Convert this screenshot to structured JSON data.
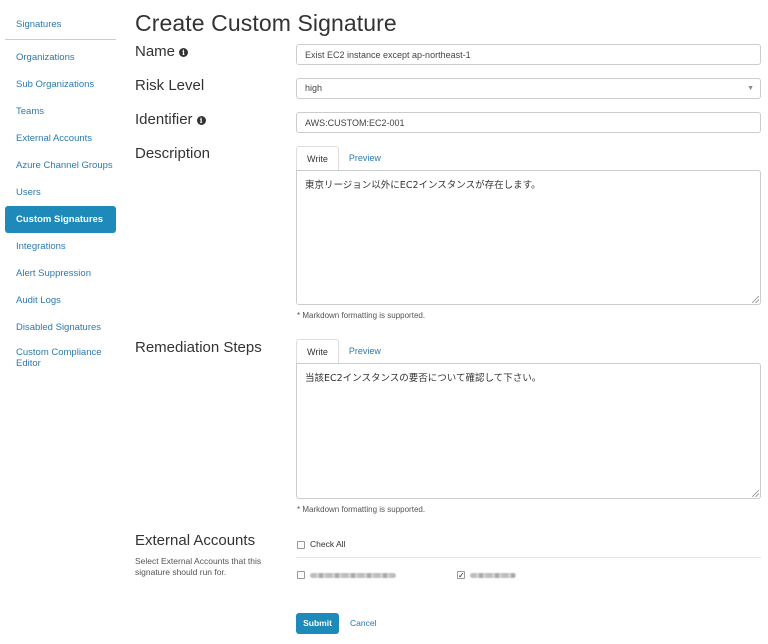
{
  "sidebar": {
    "items": [
      {
        "label": "Signatures"
      },
      {
        "label": "Organizations"
      },
      {
        "label": "Sub Organizations"
      },
      {
        "label": "Teams"
      },
      {
        "label": "External Accounts"
      },
      {
        "label": "Azure Channel Groups"
      },
      {
        "label": "Users"
      },
      {
        "label": "Custom Signatures",
        "active": true
      },
      {
        "label": "Integrations"
      },
      {
        "label": "Alert Suppression"
      },
      {
        "label": "Audit Logs"
      },
      {
        "label": "Disabled Signatures"
      },
      {
        "label": "Custom Compliance Editor"
      }
    ]
  },
  "page": {
    "title": "Create Custom Signature"
  },
  "form": {
    "name": {
      "label": "Name",
      "value": "Exist EC2 instance except ap-northeast-1",
      "icon": "info-icon"
    },
    "risk_level": {
      "label": "Risk Level",
      "value": "high"
    },
    "identifier": {
      "label": "Identifier",
      "value": "AWS:CUSTOM:EC2-001",
      "icon": "info-icon"
    },
    "description": {
      "label": "Description",
      "tab_write": "Write",
      "tab_preview": "Preview",
      "value": "東京リージョン以外にEC2インスタンスが存在します。",
      "hint": "* Markdown formatting is supported."
    },
    "remediation": {
      "label": "Remediation Steps",
      "tab_write": "Write",
      "tab_preview": "Preview",
      "value": "当該EC2インスタンスの要否について確認して下さい。",
      "hint": "* Markdown formatting is supported."
    },
    "external_accounts": {
      "label": "External Accounts",
      "description": "Select External Accounts that this signature should run for.",
      "check_all_label": "Check All",
      "check_all_checked": false,
      "accounts": [
        {
          "checked": false
        },
        {
          "checked": true
        }
      ]
    },
    "submit_label": "Submit",
    "cancel_label": "Cancel"
  },
  "colors": {
    "accent": "#1d8ab9",
    "link": "#2a7ab0"
  }
}
